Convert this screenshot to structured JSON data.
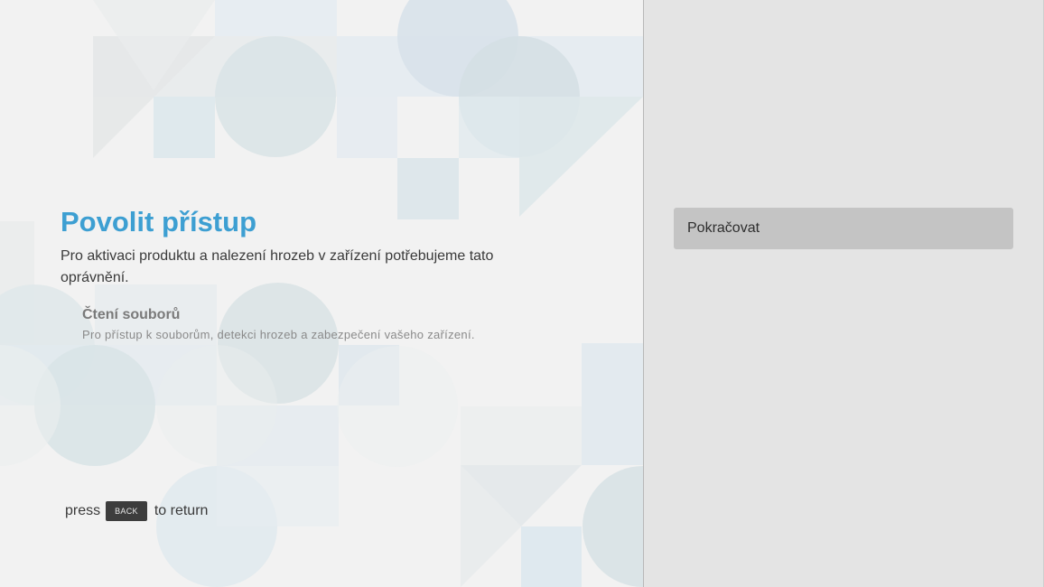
{
  "main": {
    "title": "Povolit přístup",
    "description": "Pro aktivaci produktu a nalezení hrozeb v zařízení potřebujeme tato oprávnění.",
    "permission": {
      "name": "Čtení souborů",
      "description": "Pro přístup k souborům, detekci hrozeb a zabezpečení vašeho zařízení."
    },
    "back_hint": {
      "prefix": "press",
      "key": "BACK",
      "suffix": "to return"
    }
  },
  "sidebar": {
    "continue_label": "Pokračovat"
  },
  "colors": {
    "accent": "#3d9fd2",
    "left_background": "#f2f2f2",
    "right_background": "#e4e4e4",
    "button_background": "#c4c4c4"
  }
}
